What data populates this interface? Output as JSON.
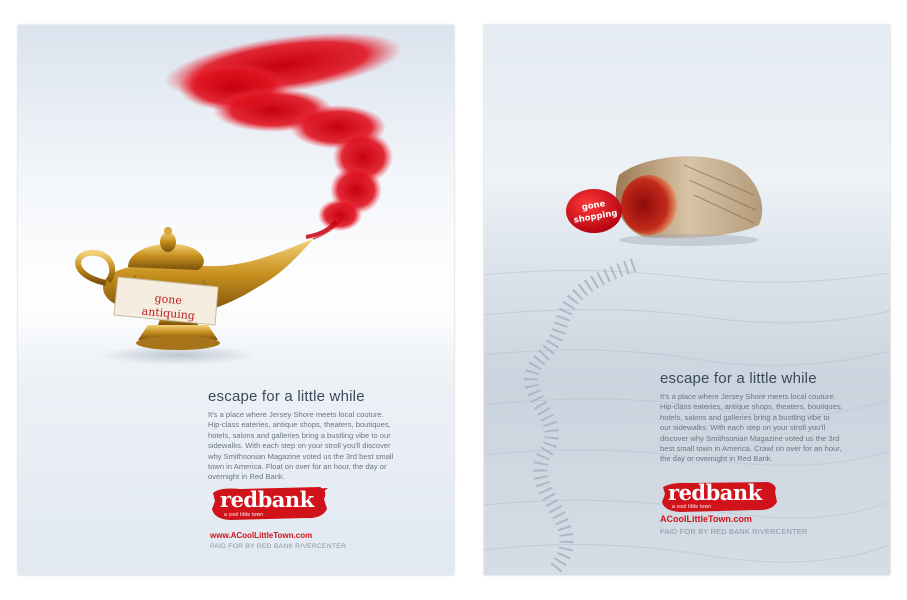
{
  "colors": {
    "brand_red": "#d0131b",
    "headline": "#3a4a5c",
    "body": "#6b7684"
  },
  "left_ad": {
    "sign_line1": "gone",
    "sign_line2": "antiquing",
    "headline": "escape for a little while",
    "body_lines": [
      "It's a place where Jersey Shore meets local couture.",
      "Hip-class eateries, antique shops, theaters, boutiques,",
      "hotels, salons and galleries bring a bustling vibe to our",
      "sidewalks. With each step on your stroll you'll discover",
      "why Smithsonian Magazine voted us the 3rd best small",
      "town in America. Float on over for an hour, the day or",
      "overnight in Red Bank."
    ],
    "logo": {
      "brand": "redbank",
      "tagline": "a cool little town"
    },
    "url": "www.ACoolLittleTown.com",
    "paid": "PAID FOR BY RED BANK RIVERCENTER"
  },
  "right_ad": {
    "rock_line1": "gone",
    "rock_line2": "shopping",
    "headline": "escape for a little while",
    "body_lines": [
      "It's a place where Jersey Shore meets local couture.",
      "Hip-class eateries, antique shops, theaters, boutiques,",
      "hotels, salons and galleries bring a bustling vibe to",
      "our sidewalks. With each step on your stroll you'll",
      "discover why Smithsonian Magazine voted us the 3rd",
      "best small town in America. Crawl on over for an hour,",
      "the day or overnight in Red Bank."
    ],
    "logo": {
      "brand": "redbank",
      "tagline": "a cool little town"
    },
    "url": "ACoolLittleTown.com",
    "paid": "PAID FOR BY RED BANK RIVERCENTER"
  }
}
